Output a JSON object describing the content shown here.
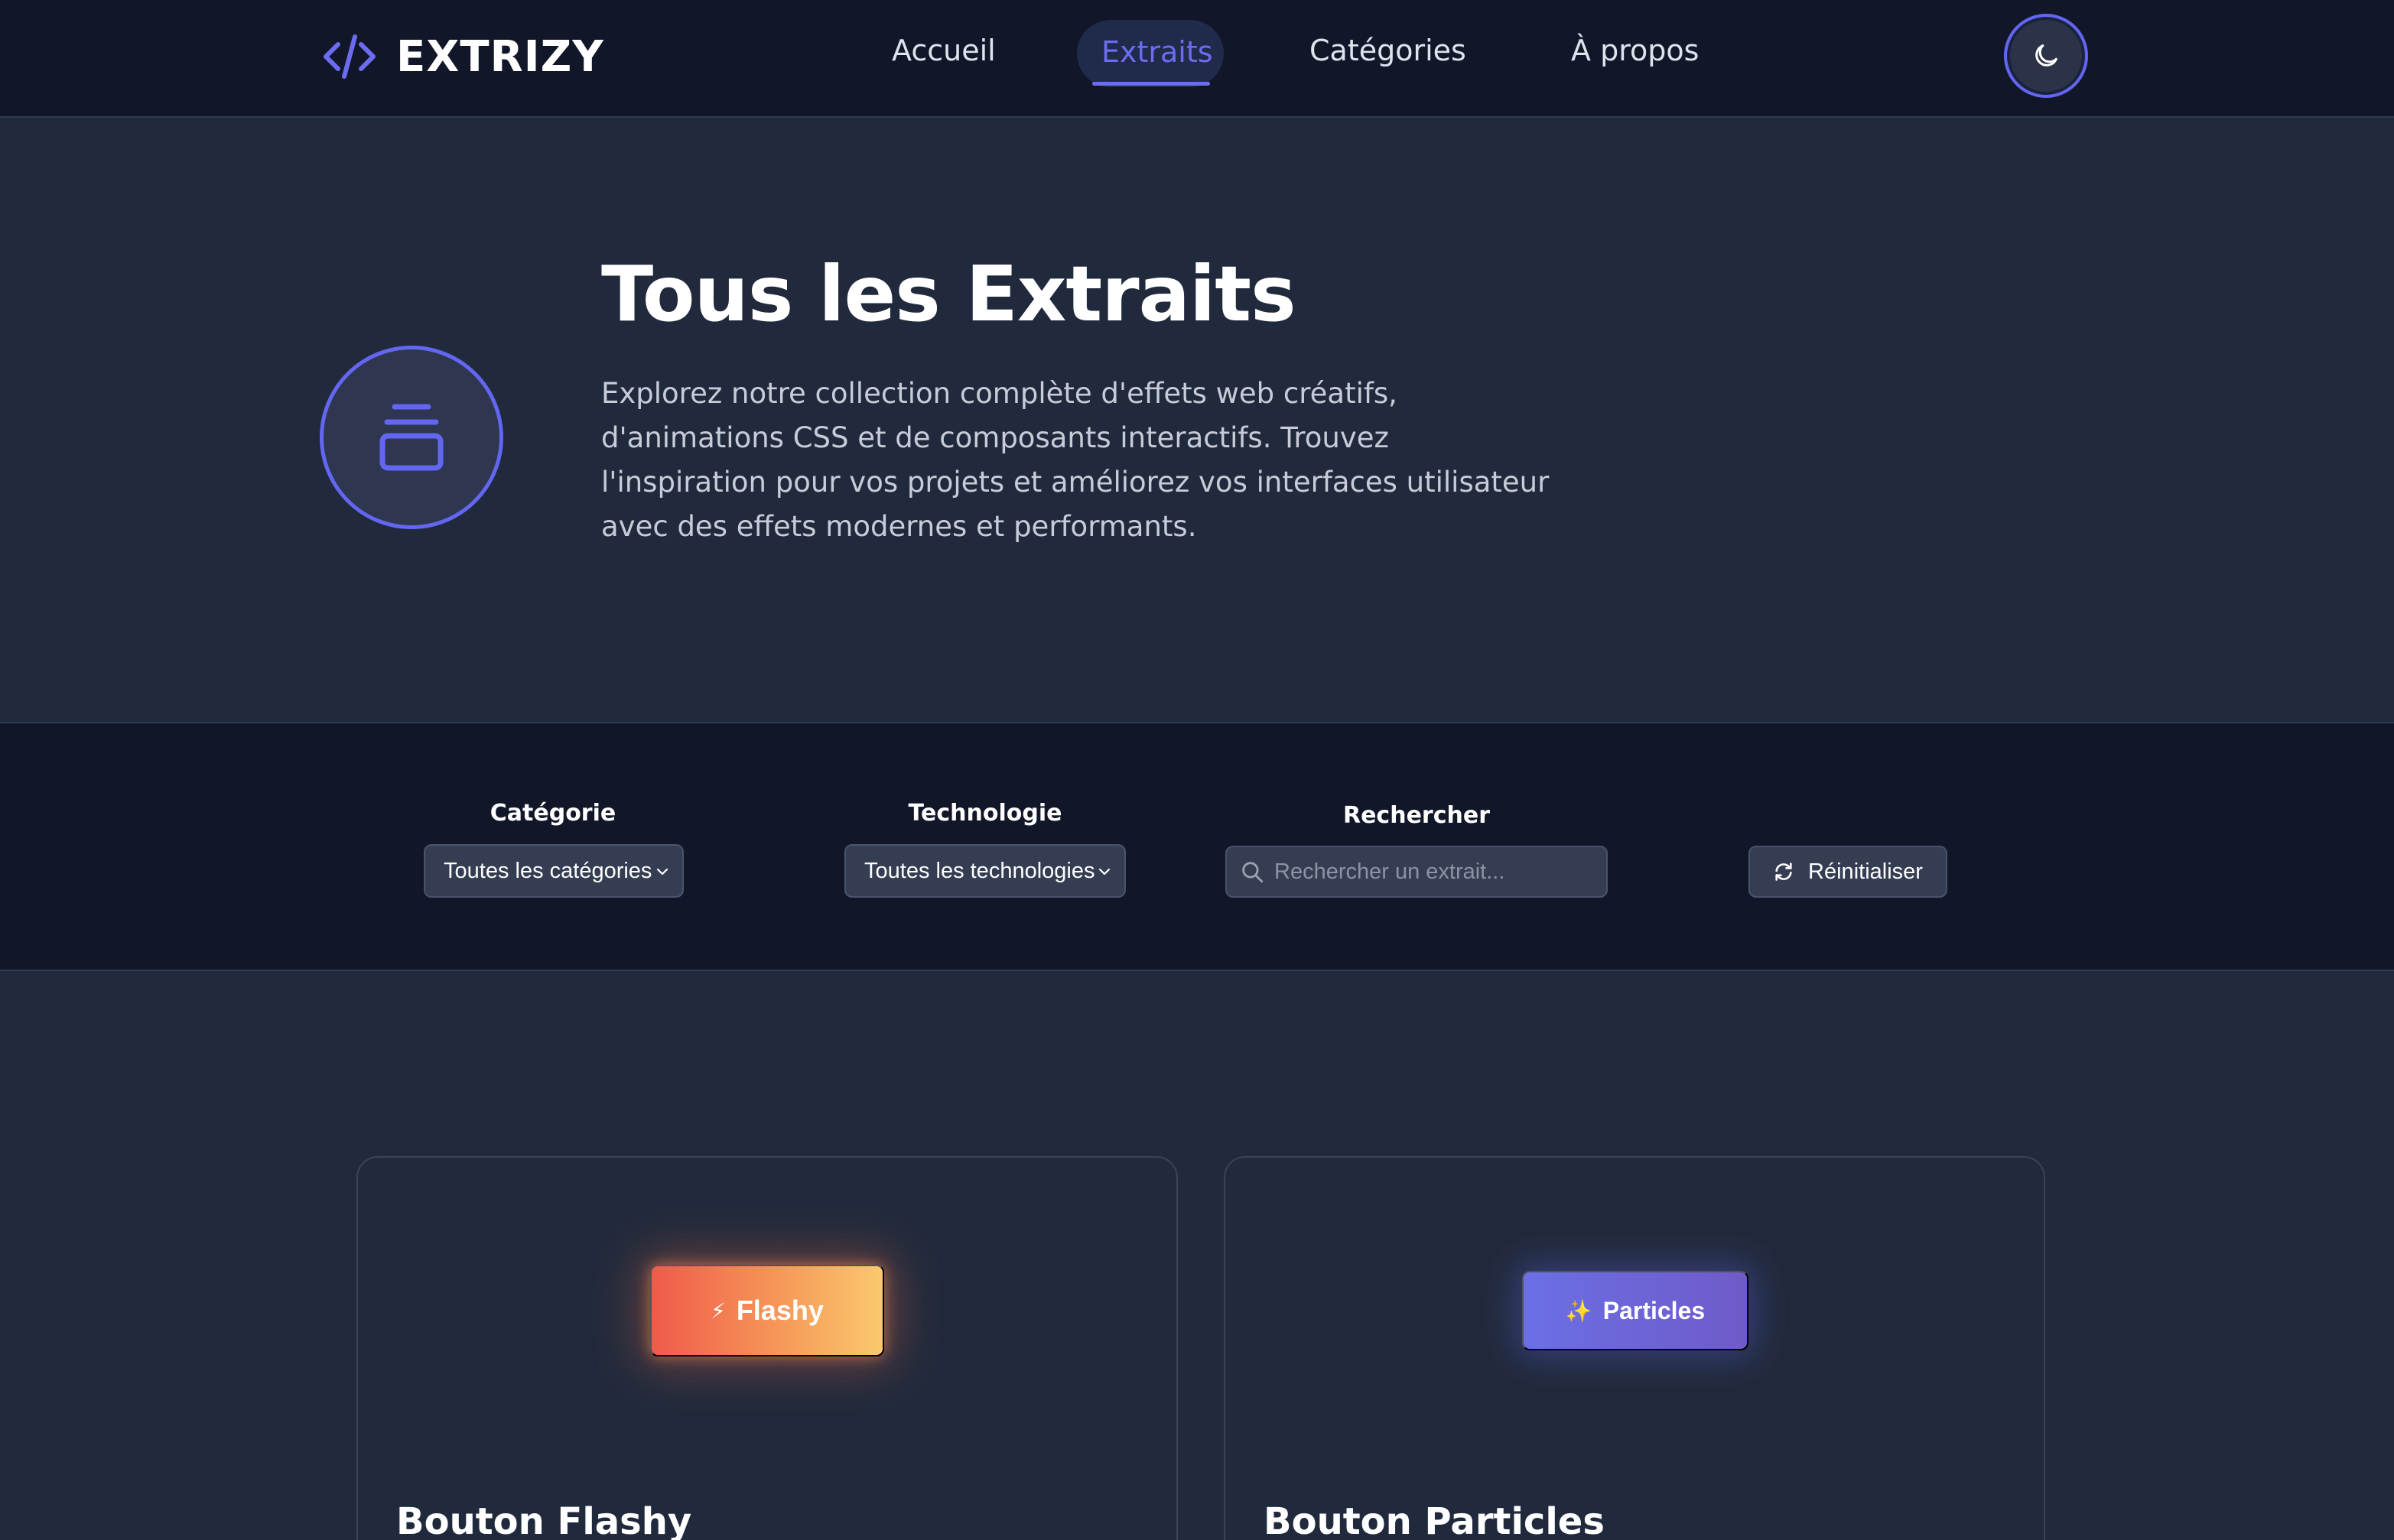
{
  "brand": {
    "name": "EXTRIZY",
    "accent": "#6366f1"
  },
  "nav": {
    "links": [
      {
        "label": "Accueil"
      },
      {
        "label": "Extraits",
        "active": true
      },
      {
        "label": "Catégories"
      },
      {
        "label": "À propos"
      }
    ],
    "theme_toggle_icon": "moon-icon"
  },
  "hero": {
    "icon": "layers-stack-icon",
    "title": "Tous les Extraits",
    "description": "Explorez notre collection complète d'effets web créatifs, d'animations CSS et de composants interactifs. Trouvez l'inspiration pour vos projets et améliorez vos interfaces utilisateur avec des effets modernes et performants."
  },
  "filters": {
    "category": {
      "label": "Catégorie",
      "value": "Toutes les catégories"
    },
    "technology": {
      "label": "Technologie",
      "value": "Toutes les technologies"
    },
    "search": {
      "label": "Rechercher",
      "placeholder": "Rechercher un extrait..."
    },
    "reset": {
      "label": "Réinitialiser",
      "icon": "refresh-icon"
    }
  },
  "cards": [
    {
      "title": "Bouton Flashy",
      "demo_label": "Flashy",
      "demo_glyph": "⚡"
    },
    {
      "title": "Bouton Particles",
      "demo_label": "Particles",
      "demo_glyph": "✨"
    }
  ]
}
